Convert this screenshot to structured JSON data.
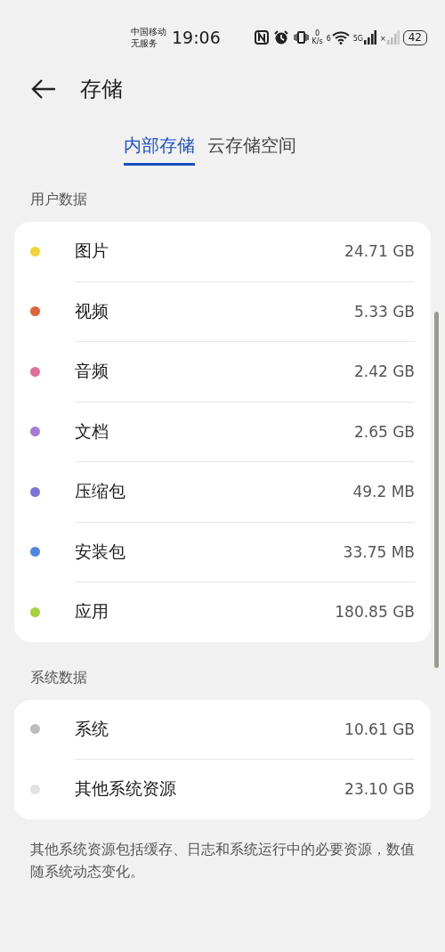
{
  "status_bar": {
    "carrier": "中国移动",
    "service": "无服务",
    "time": "19:06",
    "speed_value": "0",
    "speed_unit": "K/s",
    "wifi_label": "6",
    "network_label": "5G",
    "no_sim_mark": "×",
    "battery": "42"
  },
  "header": {
    "title": "存储"
  },
  "tabs": [
    {
      "label": "内部存储",
      "selected": true
    },
    {
      "label": "云存储空间",
      "selected": false
    }
  ],
  "sections": [
    {
      "title": "用户数据",
      "items": [
        {
          "name": "图片",
          "size": "24.71 GB",
          "color": "#f3d33a"
        },
        {
          "name": "视频",
          "size": "5.33 GB",
          "color": "#e0623a"
        },
        {
          "name": "音频",
          "size": "2.42 GB",
          "color": "#e0719c"
        },
        {
          "name": "文档",
          "size": "2.65 GB",
          "color": "#a97ad6"
        },
        {
          "name": "压缩包",
          "size": "49.2 MB",
          "color": "#7b74d8"
        },
        {
          "name": "安装包",
          "size": "33.75 MB",
          "color": "#4f86e0"
        },
        {
          "name": "应用",
          "size": "180.85 GB",
          "color": "#a5d33e"
        }
      ]
    },
    {
      "title": "系统数据",
      "items": [
        {
          "name": "系统",
          "size": "10.61 GB",
          "color": "#bdbdbd"
        },
        {
          "name": "其他系统资源",
          "size": "23.10 GB",
          "color": "#e3e3e3"
        }
      ]
    }
  ],
  "footnote": "其他系统资源包括缓存、日志和系统运行中的必要资源，数值随系统动态变化。"
}
